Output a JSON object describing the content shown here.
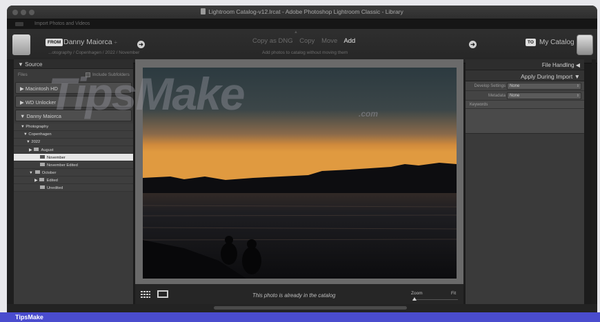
{
  "window": {
    "title": "Lightroom Catalog-v12.lrcat - Adobe Photoshop Lightroom Classic - Library",
    "subtitle": "Import Photos and Videos"
  },
  "header": {
    "from_badge": "FROM",
    "from_name": "Danny Maiorca",
    "from_caret": "÷",
    "from_path": "...otography / Copenhagen / 2022 / November",
    "modes": [
      "Copy as DNG",
      "Copy",
      "Move",
      "Add"
    ],
    "active_mode": "Add",
    "mode_description": "Add photos to catalog without moving them",
    "to_badge": "TO",
    "to_name": "My Catalog",
    "arrow": "➜"
  },
  "source": {
    "title": "▼  Source",
    "files_label": "Files",
    "include_subfolders": "Include Subfolders",
    "volumes": [
      "▶  Macintosh HD",
      "▶  WD Unlocker",
      "▼  Danny Maiorca"
    ],
    "tree": [
      {
        "label": "▼  Photography",
        "indent": 10,
        "folder": false,
        "selected": false,
        "dim": false
      },
      {
        "label": "▼  Copenhagen",
        "indent": 14,
        "folder": false,
        "selected": false,
        "dim": false
      },
      {
        "label": "▼  2022",
        "indent": 18,
        "folder": false,
        "selected": false,
        "dim": false
      },
      {
        "label": "August",
        "prefix": "▶",
        "indent": 22,
        "folder": true,
        "selected": false,
        "dim": false
      },
      {
        "label": "November",
        "prefix": "",
        "indent": 30,
        "folder": true,
        "selected": true,
        "dim": false
      },
      {
        "label": "November Edited",
        "prefix": "",
        "indent": 30,
        "folder": true,
        "selected": false,
        "dim": false
      },
      {
        "label": "October",
        "prefix": "▼",
        "indent": 22,
        "folder": true,
        "selected": false,
        "dim": false
      },
      {
        "label": "Edited",
        "prefix": "▶",
        "indent": 30,
        "folder": true,
        "selected": false,
        "dim": false
      },
      {
        "label": "Unedited",
        "prefix": "",
        "indent": 30,
        "folder": true,
        "selected": false,
        "dim": false
      }
    ]
  },
  "right_panel": {
    "file_handling": "File Handling  ◀",
    "apply_during_import": "Apply During Import  ▼",
    "develop_label": "Develop Settings",
    "develop_value": "None",
    "metadata_label": "Metadata",
    "metadata_value": "None",
    "keywords_label": "Keywords",
    "select_arrow": "⇕"
  },
  "toolbar": {
    "message": "This photo is already in the catalog",
    "zoom_label": "Zoom",
    "fit_label": "Fit",
    "zoom_level": 0
  },
  "footer": {
    "brand": "TipsMake"
  },
  "watermark": {
    "main": "TipsMake",
    "sub": ".com"
  },
  "colors": {
    "accent_footer": "#4a4cce",
    "panel_bg": "#3a3a3a",
    "window_bg": "#1c1c1c"
  }
}
